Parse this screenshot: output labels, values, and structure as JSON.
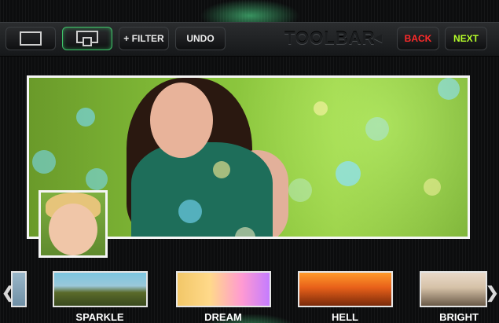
{
  "toolbar": {
    "filter_label": "+ FILTER",
    "undo_label": "UNDO",
    "brand_label": "TOOLBAR",
    "back_label": "BACK",
    "next_label": "NEXT"
  },
  "colors": {
    "accent_green": "#3fc46a",
    "back_red": "#ff2a2a",
    "next_lime": "#b6ff2a"
  },
  "filters": {
    "items": [
      {
        "label": "SPARKLE"
      },
      {
        "label": "DREAM"
      },
      {
        "label": "HELL"
      },
      {
        "label": "BRIGHT"
      }
    ]
  },
  "icons": {
    "prev": "chevron-left-icon",
    "next": "chevron-right-icon"
  }
}
